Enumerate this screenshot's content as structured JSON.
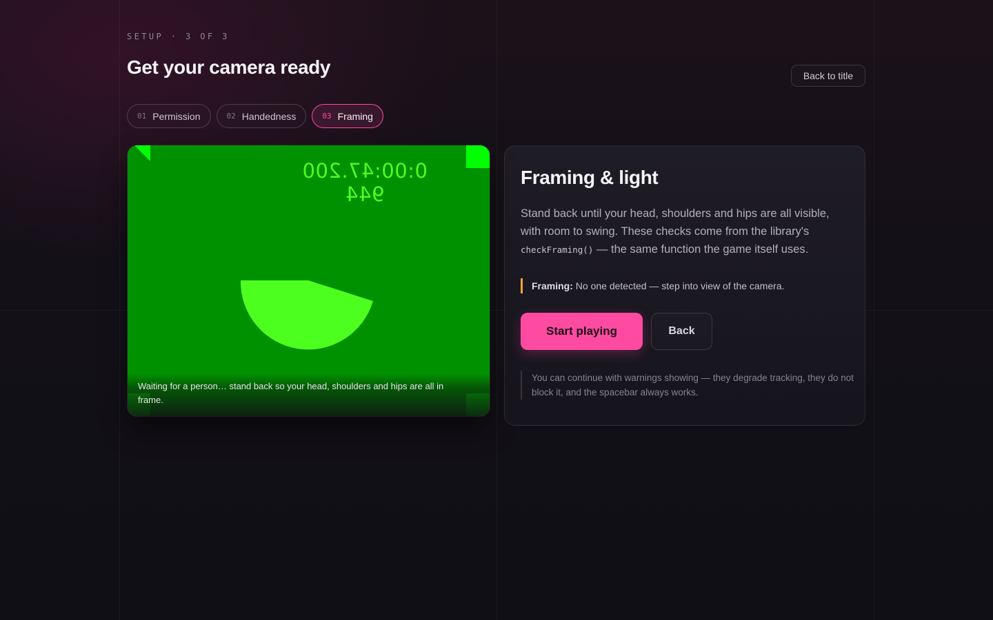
{
  "header": {
    "eyebrow": "SETUP · 3 OF 3",
    "title": "Get your camera ready",
    "back_to_title_label": "Back to title"
  },
  "steps": [
    {
      "num": "01",
      "label": "Permission",
      "active": false
    },
    {
      "num": "02",
      "label": "Handedness",
      "active": false
    },
    {
      "num": "03",
      "label": "Framing",
      "active": true
    }
  ],
  "camera": {
    "timecode_overlay": "0:00:47.200 944",
    "caption": "Waiting for a person… stand back so your head, shoulders and hips are all in frame.",
    "colors": {
      "background": "#009100",
      "shape": "#4dff1f",
      "corner_marker": "#00ff00"
    }
  },
  "panel": {
    "title": "Framing & light",
    "body_before_code": "Stand back until your head, shoulders and hips are all visible, with room to swing. These checks come from the library's ",
    "body_code": "checkFraming()",
    "body_after_code": " — the same function the game itself uses.",
    "status_label": "Framing:",
    "status_text": " No one detected — step into view of the camera.",
    "primary_button": "Start playing",
    "secondary_button": "Back",
    "note": "You can continue with warnings showing — they degrade tracking, they do not block it, and the spacebar always works."
  },
  "colors": {
    "accent": "#ff4aa2",
    "warning": "#f2a63a",
    "background": "#141018"
  }
}
